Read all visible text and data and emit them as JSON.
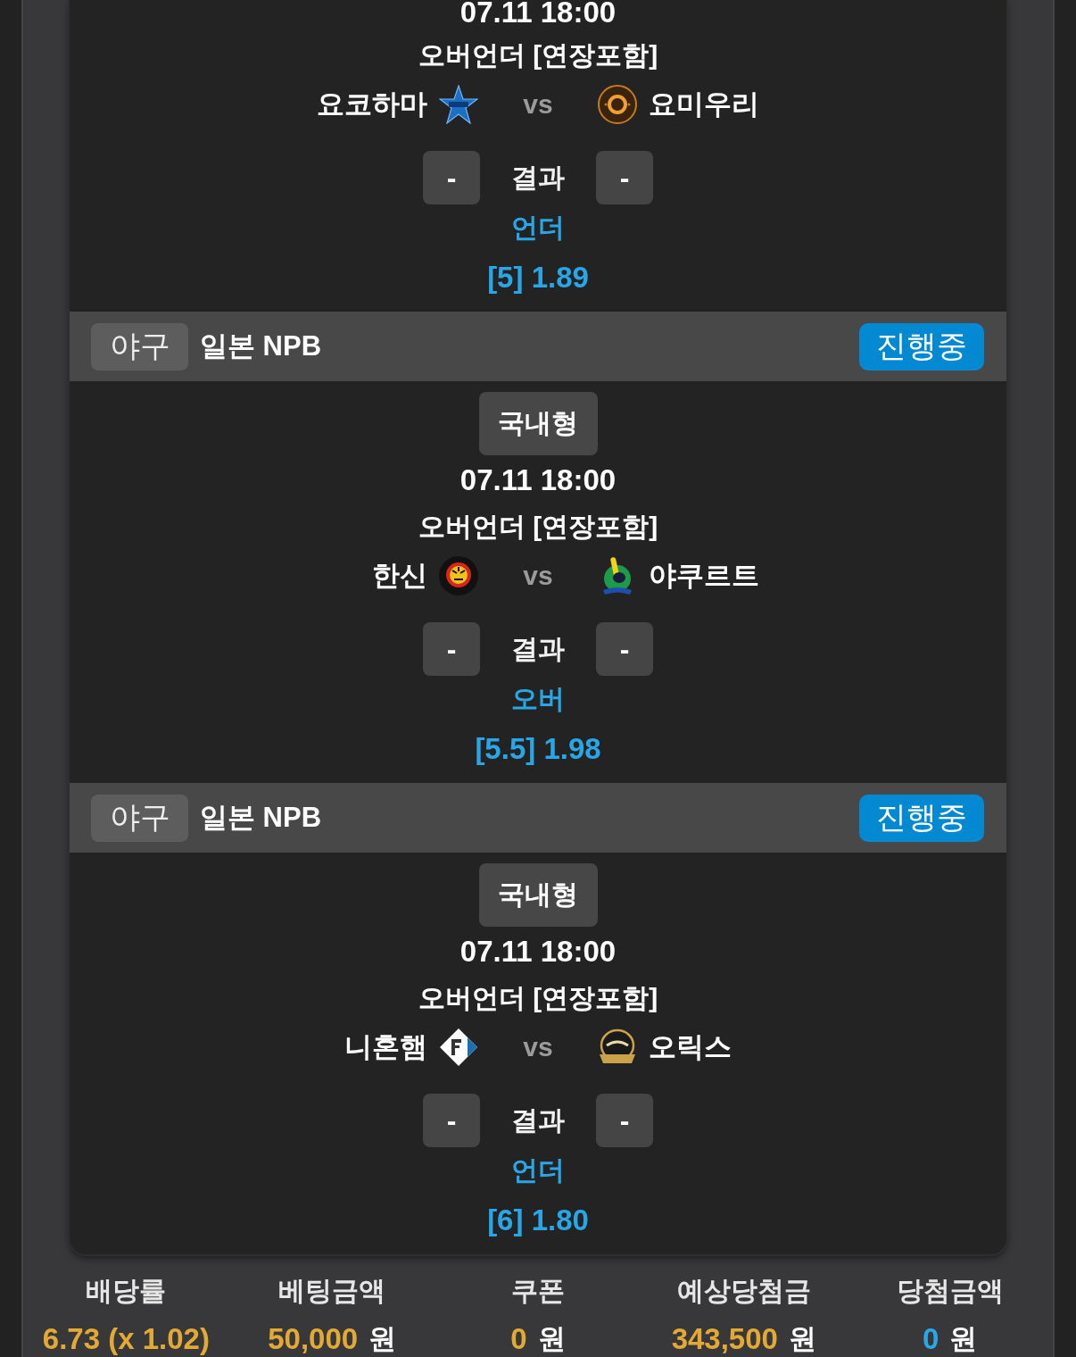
{
  "matches": [
    {
      "date": "07.11 18:00",
      "market": "오버언더 [연장포함]",
      "home_team": "요코하마",
      "versus": "vs",
      "away_team": "요미우리",
      "home_score": "-",
      "result_label": "결과",
      "away_score": "-",
      "pick": "언더",
      "odds": "[5] 1.89"
    },
    {
      "sport": "야구",
      "league": "일본 NPB",
      "status": "진행중",
      "bet_type": "국내형",
      "date": "07.11 18:00",
      "market": "오버언더 [연장포함]",
      "home_team": "한신",
      "versus": "vs",
      "away_team": "야쿠르트",
      "home_score": "-",
      "result_label": "결과",
      "away_score": "-",
      "pick": "오버",
      "odds": "[5.5] 1.98"
    },
    {
      "sport": "야구",
      "league": "일본 NPB",
      "status": "진행중",
      "bet_type": "국내형",
      "date": "07.11 18:00",
      "market": "오버언더 [연장포함]",
      "home_team": "니혼햄",
      "versus": "vs",
      "away_team": "오릭스",
      "home_score": "-",
      "result_label": "결과",
      "away_score": "-",
      "pick": "언더",
      "odds": "[6] 1.80"
    }
  ],
  "summary": [
    {
      "label": "배당률",
      "value": "6.73 (x 1.02)",
      "color": "#e3a935"
    },
    {
      "label": "베팅금액",
      "value": "50,000",
      "unit": "원",
      "color": "#e3a935"
    },
    {
      "label": "쿠폰",
      "value": "0",
      "unit": "원",
      "color": "#e3a935"
    },
    {
      "label": "예상당첨금",
      "value": "343,500",
      "unit": "원",
      "color": "#e3a935"
    },
    {
      "label": "당첨금액",
      "value": "0",
      "unit": "원",
      "color": "#29a8e8"
    }
  ]
}
